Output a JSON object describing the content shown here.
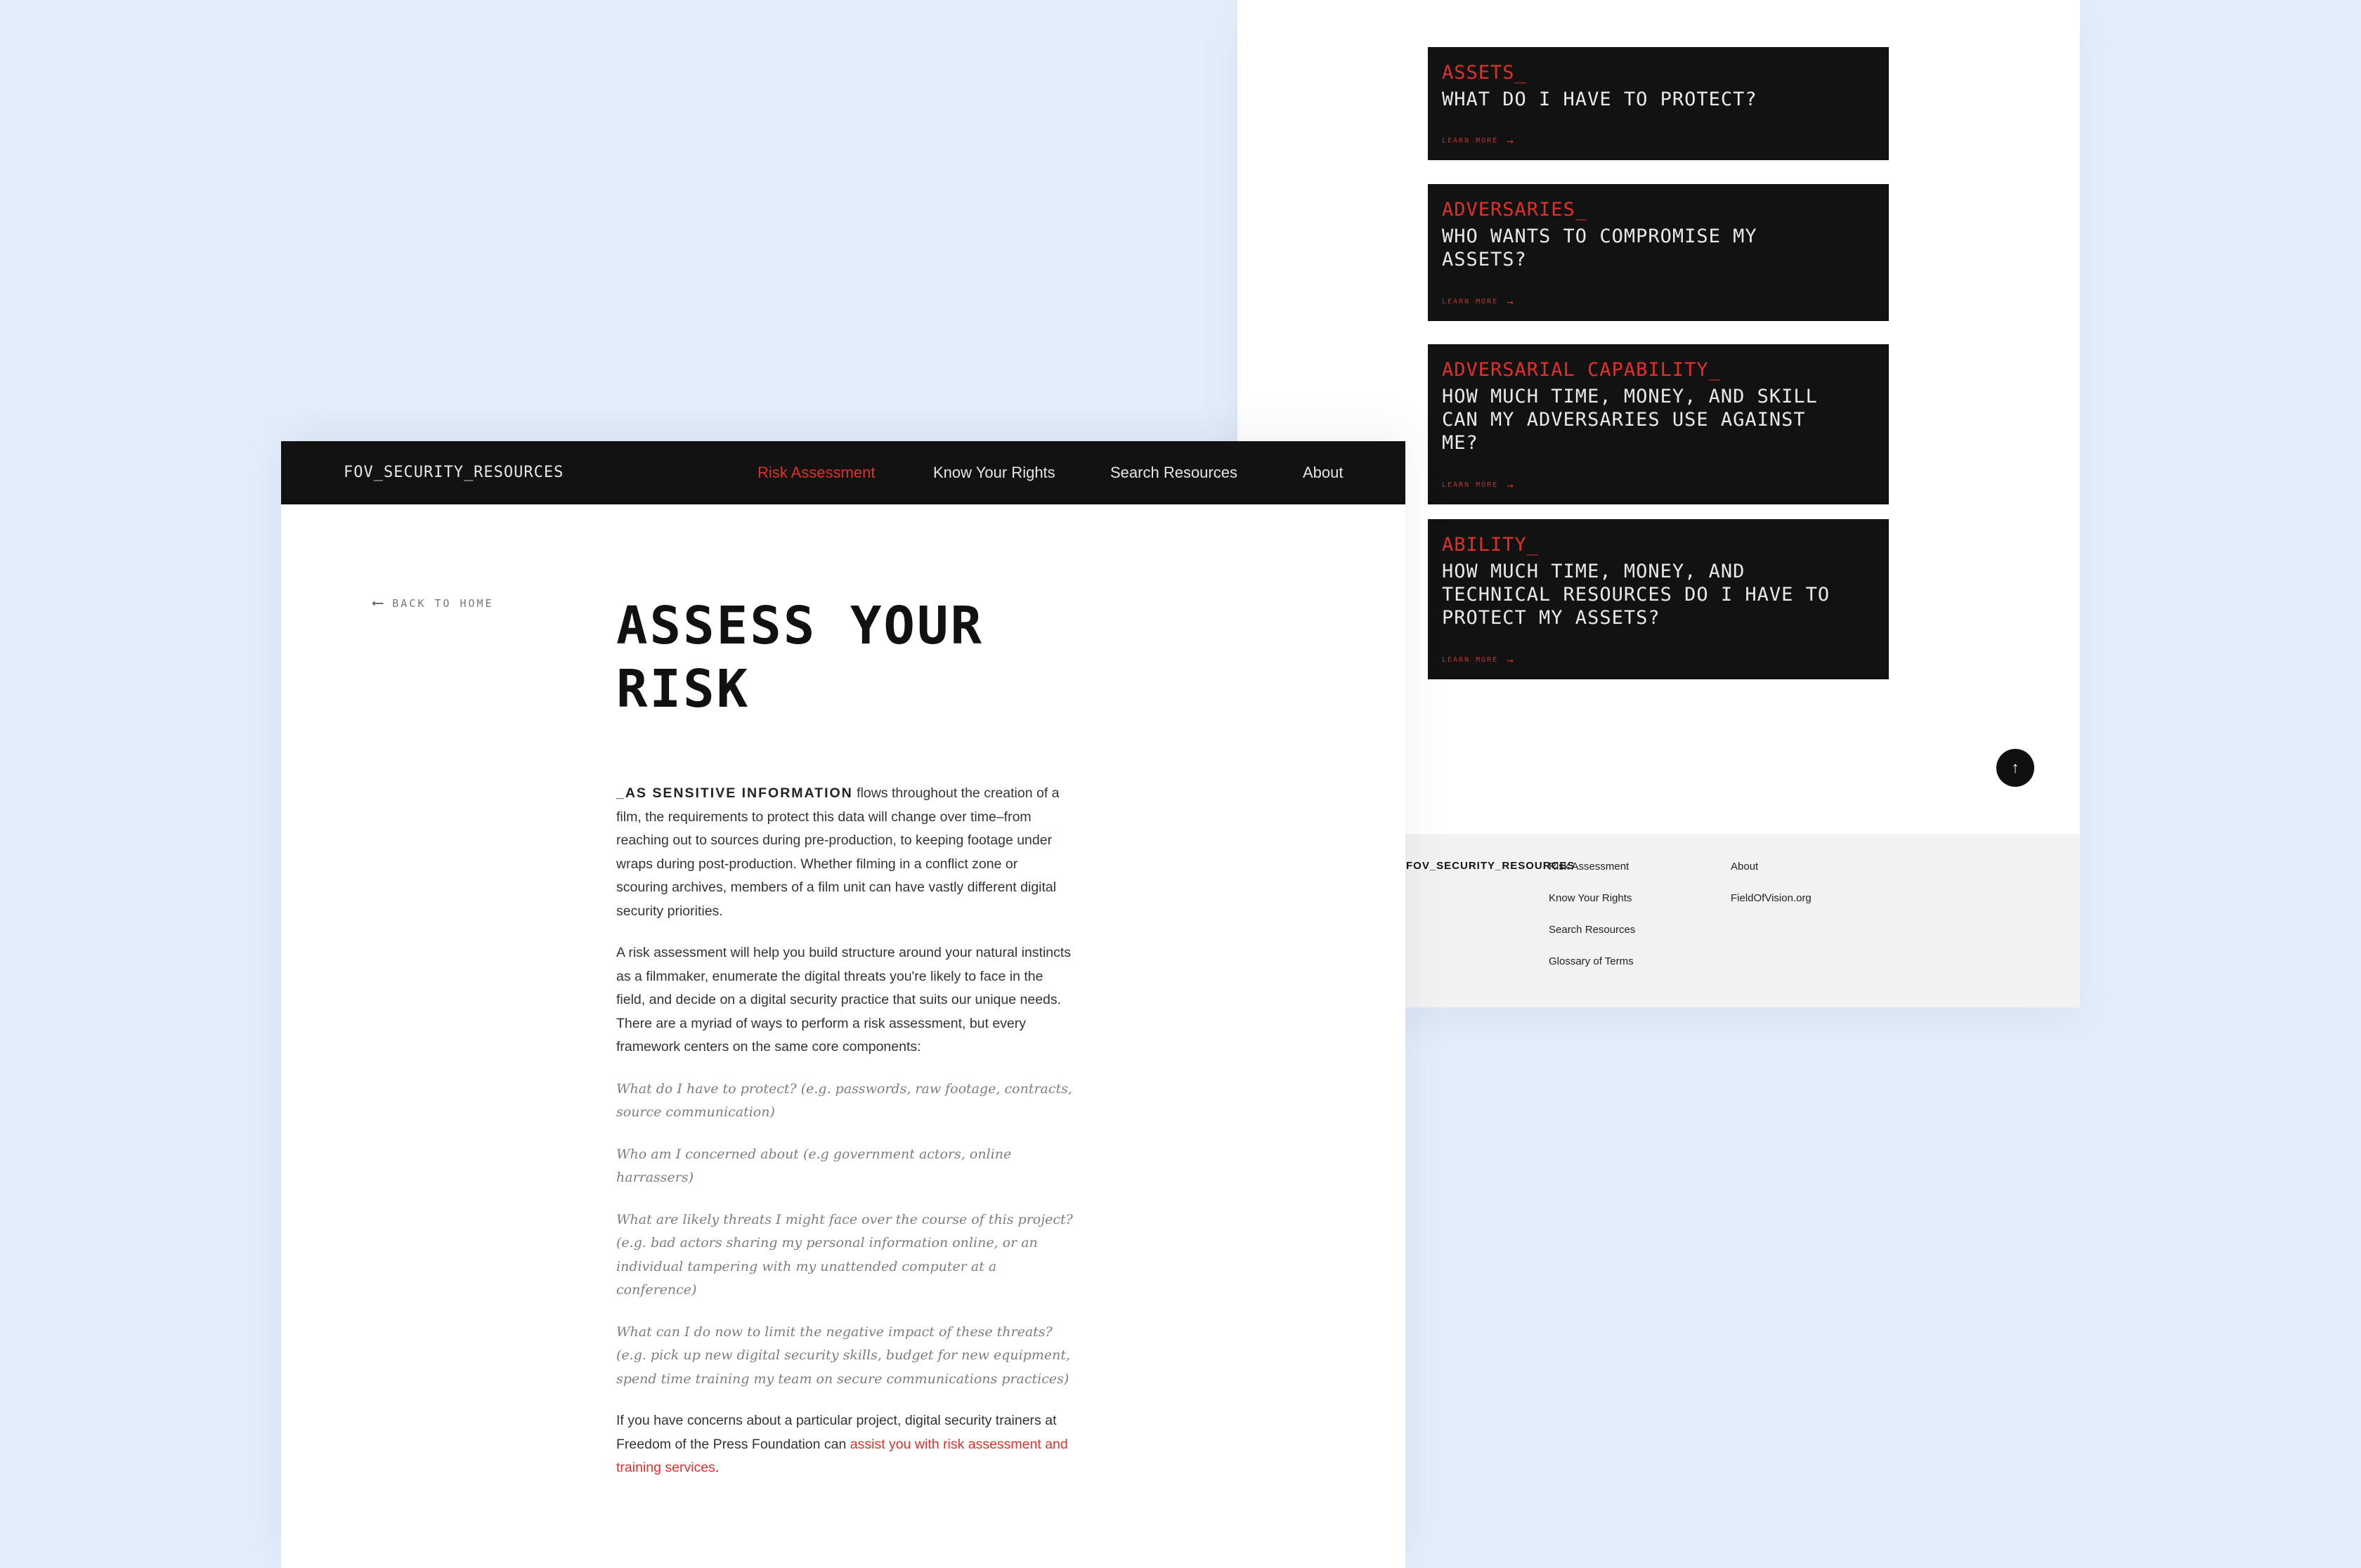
{
  "back_panel": {
    "cards": [
      {
        "kicker": "ASSETS_",
        "question": "WHAT DO I HAVE TO PROTECT?",
        "link": "LEARN MORE"
      },
      {
        "kicker": "ADVERSARIES_",
        "question": "WHO WANTS TO COMPROMISE MY ASSETS?",
        "link": "LEARN MORE"
      },
      {
        "kicker": "ADVERSARIAL CAPABILITY_",
        "question": "HOW MUCH TIME, MONEY, AND SKILL CAN MY ADVERSARIES USE AGAINST ME?",
        "link": "LEARN MORE"
      },
      {
        "kicker": "ABILITY_",
        "question": "HOW MUCH TIME, MONEY, AND TECHNICAL RESOURCES DO I HAVE TO PROTECT MY ASSETS?",
        "link": "LEARN MORE"
      }
    ],
    "card_link_arrow": "→",
    "scroll_top_icon": "↑",
    "footer": {
      "brand": "FOV_SECURITY_RESOURCES",
      "col1": [
        "Risk Assessment",
        "Know Your Rights",
        "Search Resources",
        "Glossary of Terms"
      ],
      "col2": [
        "About",
        "FieldOfVision.org"
      ]
    }
  },
  "front_panel": {
    "nav": {
      "brand": "FOV_SECURITY_RESOURCES",
      "items": [
        "Risk Assessment",
        "Know Your Rights",
        "Search Resources",
        "About"
      ],
      "active_index": 0
    },
    "back_link": {
      "arrow": "⟵",
      "label": "BACK TO HOME"
    },
    "title": "ASSESS YOUR RISK",
    "intro_lead": "_AS SENSITIVE INFORMATION",
    "intro_rest": " flows throughout the creation of a film, the requirements to protect this data will change over time–from reaching out to sources during pre-production, to keeping footage under wraps during post-production. Whether filming in a conflict zone or scouring archives, members of a film unit can have vastly different digital security priorities.",
    "para2": "A risk assessment will help you build structure around your natural instincts as a filmmaker, enumerate the digital threats you're likely to face in the field, and decide on a digital security practice that suits our unique needs. There are a myriad of ways to perform a risk assessment, but every framework centers on the same core components:",
    "questions": [
      "What do I have to protect? (e.g. passwords, raw footage, contracts, source communication)",
      "Who am I concerned about (e.g government actors, online harrassers)",
      "What are likely threats I might face over the course of this project? (e.g. bad actors sharing my personal information online, or an individual tampering with my unattended computer at a conference)",
      "What can I do now to limit the negative impact of these threats? (e.g. pick up new digital security skills, budget for new equipment, spend time training my team on secure communications practices)"
    ],
    "closing_text": "If you have concerns about a particular project, digital security trainers at Freedom of the Press Foundation can ",
    "closing_link": "assist you with risk assessment and training services",
    "closing_end": "."
  },
  "colors": {
    "background": "#e4eefb",
    "accent": "#e0302c",
    "dark": "#121212"
  }
}
